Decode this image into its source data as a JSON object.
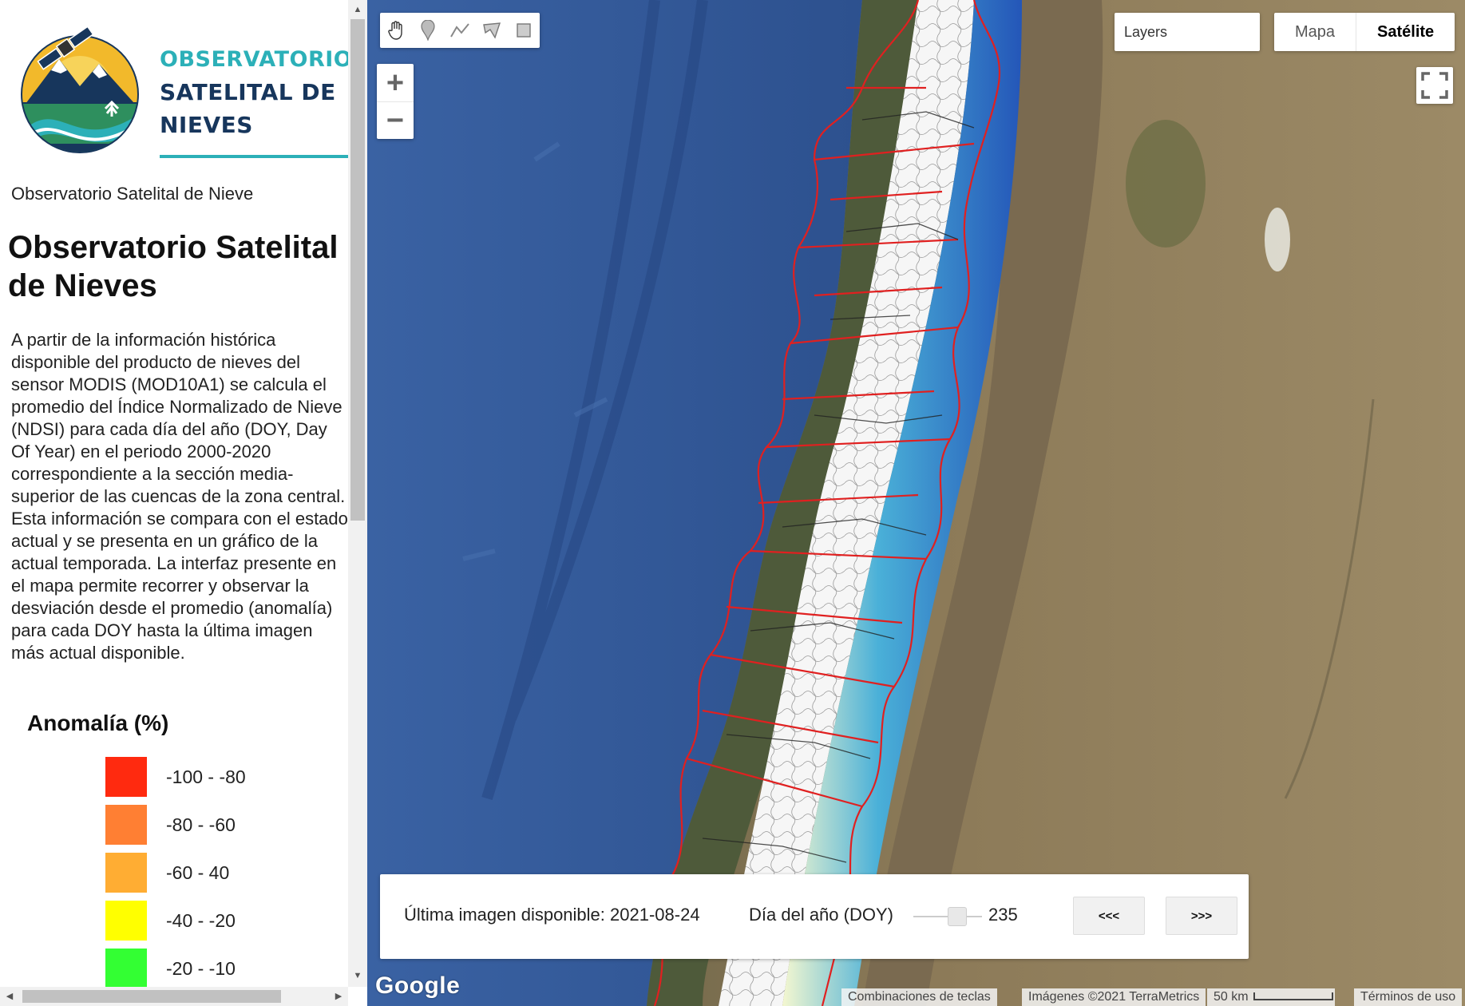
{
  "sidebar": {
    "logo": {
      "line1": "OBSERVATORIO",
      "line2": "SATELITAL DE",
      "line3": "NIEVES"
    },
    "site_name": "Observatorio Satelital de Nieve",
    "title": "Observatorio Satelital de Nieves",
    "description": "A partir de la información histórica disponible del producto de nieves del sensor MODIS (MOD10A1) se calcula el promedio del Índice Normalizado de Nieve (NDSI) para cada día del año (DOY, Day Of Year) en el periodo 2000-2020 correspondiente a la sección media-superior de las cuencas de la zona central. Esta información se compara con el estado actual y se presenta en un gráfico de la actual temporada. La interfaz presente en el mapa permite recorrer y observar la desviación desde el promedio (anomalía) para cada DOY hasta la última imagen más actual disponible.",
    "legend": {
      "title": "Anomalía (%)",
      "items": [
        {
          "label": "-100 - -80",
          "color": "#ff2a0f"
        },
        {
          "label": "-80 - -60",
          "color": "#ff7f33"
        },
        {
          "label": "-60 - 40",
          "color": "#ffad33"
        },
        {
          "label": "-40 - -20",
          "color": "#ffff00"
        },
        {
          "label": "-20 - -10",
          "color": "#33ff33"
        }
      ]
    }
  },
  "map": {
    "toolbar": {
      "tools": [
        "hand-icon",
        "marker-icon",
        "polyline-icon",
        "polygon-icon",
        "rectangle-icon"
      ]
    },
    "zoom": {
      "in_label": "+",
      "out_label": "−"
    },
    "layers_label": "Layers",
    "maptype": {
      "map_label": "Mapa",
      "satellite_label": "Satélite",
      "active": "satellite"
    },
    "info_panel": {
      "last_image": "Última imagen disponible: 2021-08-24",
      "doy_label": "Día del año (DOY)",
      "doy_value": "235",
      "doy_slider_fraction": 0.7,
      "prev_label": "<<<",
      "next_label": ">>>"
    },
    "google_logo": "Google",
    "attribution": {
      "shortcuts": "Combinaciones de teclas",
      "imagery": "Imágenes ©2021 TerraMetrics",
      "scale": "50 km",
      "terms": "Términos de uso"
    },
    "colors": {
      "ocean": "#2c4f8a",
      "land": "#8a7a5c",
      "basin_outline": "#e02020",
      "snow_deep": "#2a5fc0"
    }
  }
}
